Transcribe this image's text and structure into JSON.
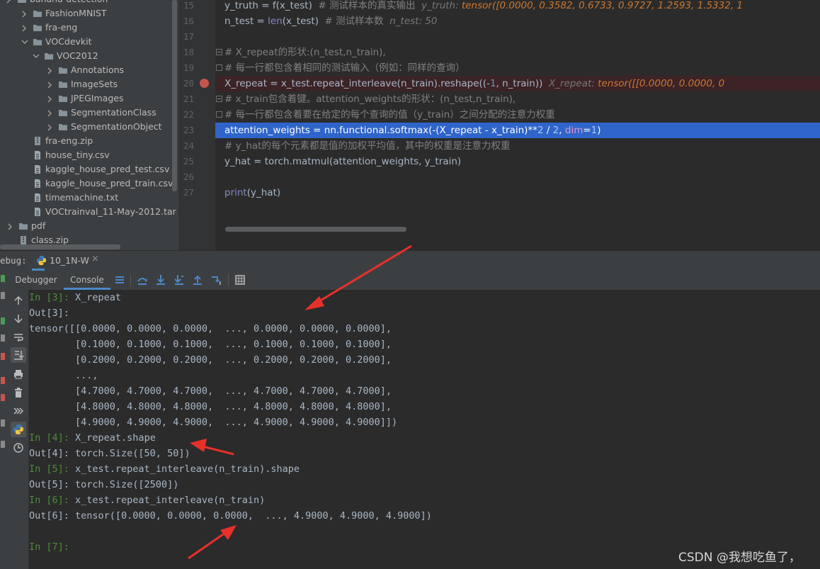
{
  "project_tree": {
    "items": [
      {
        "label": "banana-detection",
        "type": "folder",
        "expanded": false
      },
      {
        "label": "FashionMNIST",
        "type": "folder",
        "expanded": false
      },
      {
        "label": "fra-eng",
        "type": "folder",
        "expanded": false
      },
      {
        "label": "VOCdevkit",
        "type": "folder",
        "expanded": true
      },
      {
        "label": "VOC2012",
        "type": "folder",
        "expanded": true
      },
      {
        "label": "Annotations",
        "type": "folder",
        "expanded": false
      },
      {
        "label": "ImageSets",
        "type": "folder",
        "expanded": false
      },
      {
        "label": "JPEGImages",
        "type": "folder",
        "expanded": false
      },
      {
        "label": "SegmentationClass",
        "type": "folder",
        "expanded": false
      },
      {
        "label": "SegmentationObject",
        "type": "folder",
        "expanded": false
      },
      {
        "label": "fra-eng.zip",
        "type": "archive"
      },
      {
        "label": "house_tiny.csv",
        "type": "file"
      },
      {
        "label": "kaggle_house_pred_test.csv",
        "type": "file"
      },
      {
        "label": "kaggle_house_pred_train.csv",
        "type": "file"
      },
      {
        "label": "timemachine.txt",
        "type": "file"
      },
      {
        "label": "VOCtrainval_11-May-2012.tar",
        "type": "file"
      },
      {
        "label": "pdf",
        "type": "folder",
        "expanded": false
      },
      {
        "label": "class.zip",
        "type": "archive"
      }
    ]
  },
  "editor": {
    "line_numbers": [
      "15",
      "16",
      "17",
      "18",
      "19",
      "20",
      "21",
      "22",
      "23",
      "24",
      "25",
      "26",
      "27"
    ],
    "lines": {
      "l15": {
        "a": "y_truth = f(x_test)",
        "b": "  # 测试样本的真实输出",
        "c": "  y_truth: ",
        "d": "tensor([0.0000, 0.3582, 0.6733, 0.9727, 1.2593, 1.5332, 1"
      },
      "l16": {
        "a": "n_test = ",
        "b": "len",
        "c": "(x_test)",
        "d": "  # 测试样本数",
        "e": "  n_test: 50"
      },
      "l18": {
        "a": "# X_repeat的形状:(n_test,n_train),"
      },
      "l19": {
        "a": "# 每一行都包含着相同的测试输入（例如：同样的查询）"
      },
      "l20": {
        "a": "X_repeat = x_test.repeat_interleave(n_train).reshape((-",
        "b": "1",
        "c": ", n_train))",
        "d": "  X_repeat: ",
        "e": "tensor([[0.0000, 0.0000, 0"
      },
      "l21": {
        "a": "# x_train包含着键。attention_weights的形状：(n_test,n_train),"
      },
      "l22": {
        "a": "# 每一行都包含着要在给定的每个查询的值（y_train）之间分配的注意力权重"
      },
      "l23": {
        "a": "attention_weights = nn.functional.softmax(-(X_repeat - x_train)**",
        "b": "2",
        "c": " / ",
        "d": "2",
        "e": ", ",
        "f": "dim",
        "g": "=",
        "h": "1",
        "i": ")"
      },
      "l24": {
        "a": "# y_hat的每个元素都是值的加权平均值，其中的权重是注意力权重"
      },
      "l25": {
        "a": "y_hat = torch.matmul(attention_weights, y_train)"
      },
      "l27": {
        "a": "print",
        "b": "(y_hat)"
      }
    }
  },
  "debug_panel": {
    "label": "ebug:",
    "run_tab": "10_1N-W",
    "tabs": {
      "debugger": "Debugger",
      "console": "Console"
    }
  },
  "console": {
    "lines": [
      {
        "prompt": "In [3]: ",
        "text": "X_repeat"
      },
      {
        "prompt": "",
        "text": "Out[3]:"
      },
      {
        "prompt": "",
        "text": "tensor([[0.0000, 0.0000, 0.0000,  ..., 0.0000, 0.0000, 0.0000],"
      },
      {
        "prompt": "",
        "text": "        [0.1000, 0.1000, 0.1000,  ..., 0.1000, 0.1000, 0.1000],"
      },
      {
        "prompt": "",
        "text": "        [0.2000, 0.2000, 0.2000,  ..., 0.2000, 0.2000, 0.2000],"
      },
      {
        "prompt": "",
        "text": "        ...,"
      },
      {
        "prompt": "",
        "text": "        [4.7000, 4.7000, 4.7000,  ..., 4.7000, 4.7000, 4.7000],"
      },
      {
        "prompt": "",
        "text": "        [4.8000, 4.8000, 4.8000,  ..., 4.8000, 4.8000, 4.8000],"
      },
      {
        "prompt": "",
        "text": "        [4.9000, 4.9000, 4.9000,  ..., 4.9000, 4.9000, 4.9000]])"
      },
      {
        "prompt": "In [4]: ",
        "text": "X_repeat.shape"
      },
      {
        "prompt": "",
        "text": "Out[4]: torch.Size([50, 50])"
      },
      {
        "prompt": "In [5]: ",
        "text": "x_test.repeat_interleave(n_train).shape"
      },
      {
        "prompt": "",
        "text": "Out[5]: torch.Size([2500])"
      },
      {
        "prompt": "In [6]: ",
        "text": "x_test.repeat_interleave(n_train)"
      },
      {
        "prompt": "",
        "text": "Out[6]: tensor([0.0000, 0.0000, 0.0000,  ..., 4.9000, 4.9000, 4.9000])"
      },
      {
        "prompt": "",
        "text": ""
      },
      {
        "prompt": "In [7]:",
        "text": ""
      }
    ]
  },
  "watermark": "CSDN @我想吃鱼了，",
  "colors": {
    "accent": "#4a88c7",
    "annotation_arrow": "#e8302a",
    "selection": "#2f65ca",
    "breakpoint": "#c75450",
    "prompt_green": "#4e8b3a"
  }
}
